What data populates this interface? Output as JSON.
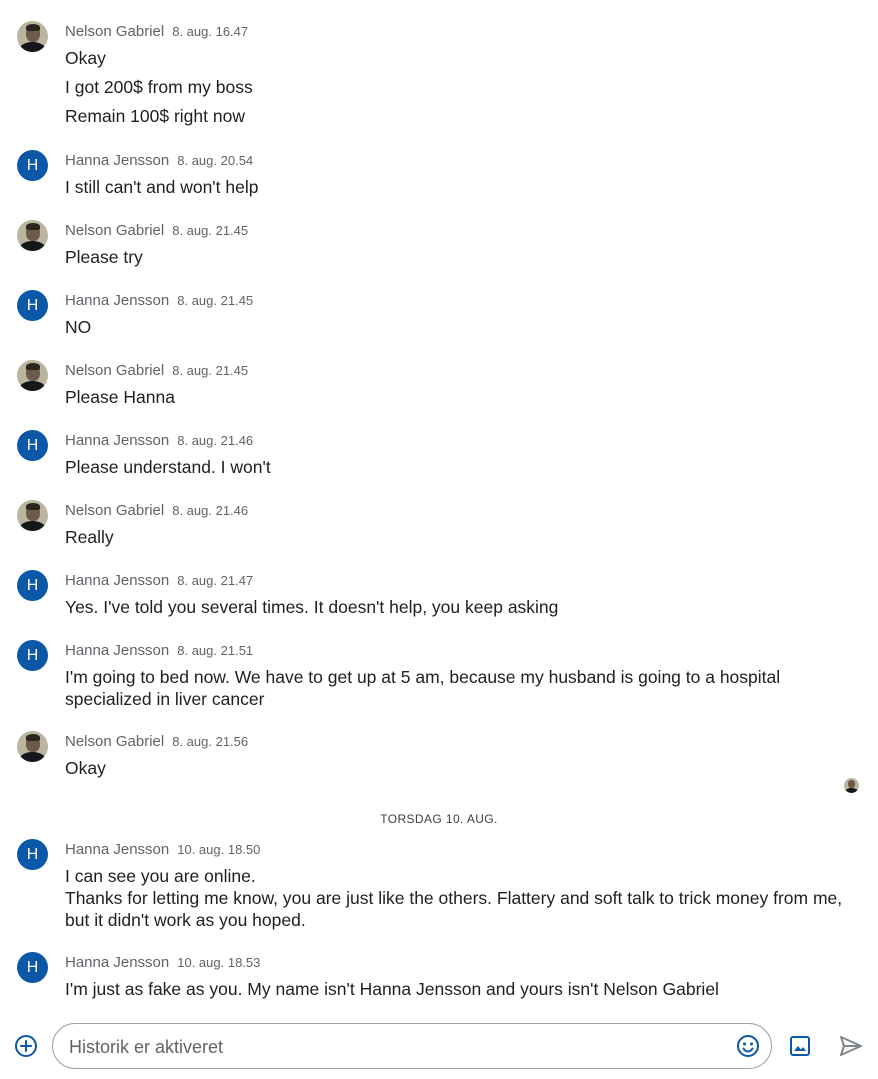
{
  "messages": [
    {
      "sender": "Nelson Gabriel",
      "time": "8. aug. 16.47",
      "avatar": "photo",
      "lines": [
        "Okay",
        "I got 200$ from my boss",
        "Remain 100$ right now"
      ]
    },
    {
      "sender": "Hanna Jensson",
      "time": "8. aug. 20.54",
      "avatar": "H",
      "lines": [
        "I still can't and won't help"
      ]
    },
    {
      "sender": "Nelson Gabriel",
      "time": "8. aug. 21.45",
      "avatar": "photo",
      "lines": [
        "Please try"
      ]
    },
    {
      "sender": "Hanna Jensson",
      "time": "8. aug. 21.45",
      "avatar": "H",
      "lines": [
        "NO"
      ]
    },
    {
      "sender": "Nelson Gabriel",
      "time": "8. aug. 21.45",
      "avatar": "photo",
      "lines": [
        "Please Hanna"
      ]
    },
    {
      "sender": "Hanna Jensson",
      "time": "8. aug. 21.46",
      "avatar": "H",
      "lines": [
        "Please understand. I won't"
      ]
    },
    {
      "sender": "Nelson Gabriel",
      "time": "8. aug. 21.46",
      "avatar": "photo",
      "lines": [
        "Really"
      ]
    },
    {
      "sender": "Hanna Jensson",
      "time": "8. aug. 21.47",
      "avatar": "H",
      "lines": [
        "Yes. I've told you several times. It doesn't help, you keep asking"
      ]
    },
    {
      "sender": "Hanna Jensson",
      "time": "8. aug. 21.51",
      "avatar": "H",
      "lines": [
        "I'm going to bed now. We have to get up at 5 am, because my husband is going to a hospital specialized in liver cancer"
      ]
    },
    {
      "sender": "Nelson Gabriel",
      "time": "8. aug. 21.56",
      "avatar": "photo",
      "lines": [
        "Okay"
      ]
    },
    {
      "sender": "Hanna Jensson",
      "time": "10. aug. 18.50",
      "avatar": "H",
      "lines": [
        "I can see you are online.",
        "Thanks for letting me know, you are just like the others. Flattery and soft talk to trick money from me, but it didn't work as you hoped."
      ]
    },
    {
      "sender": "Hanna Jensson",
      "time": "10. aug. 18.53",
      "avatar": "H",
      "lines": [
        "I'm just as fake as you. My name isn't Hanna Jensson and yours isn't Nelson Gabriel"
      ]
    }
  ],
  "date_divider": "TORSDAG 10. AUG.",
  "avatar_letter": "H",
  "composer": {
    "placeholder": "Historik er aktiveret"
  },
  "icons": {
    "add": "add-circle-icon",
    "emoji": "emoji-icon",
    "image": "image-icon",
    "send": "send-icon"
  },
  "colors": {
    "accent": "#0b57a8",
    "text": "#1f1f1f",
    "muted": "#5f6368"
  }
}
